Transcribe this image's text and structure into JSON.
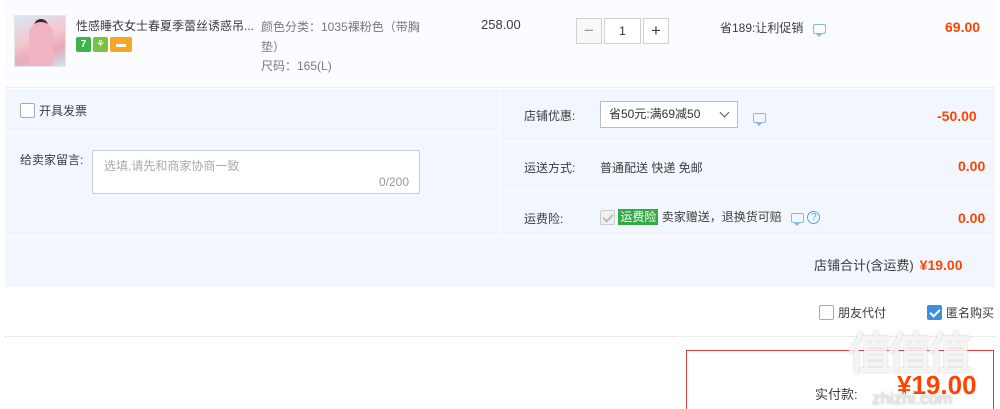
{
  "item": {
    "title": "性感睡衣女士春夏季蕾丝诱惑吊...",
    "badges": {
      "seven": "7"
    },
    "sku_color": "颜色分类：1035裸粉色（带胸垫）",
    "sku_size": "尺码：165(L)",
    "unit_price": "258.00",
    "quantity": "1",
    "promotion": "省189:让利促销",
    "subtotal": "69.00"
  },
  "invoice_label": "开具发票",
  "message": {
    "label": "给卖家留言:",
    "placeholder": "选填,请先和商家协商一致",
    "count": "0/200"
  },
  "shop_discount": {
    "label": "店铺优惠:",
    "selected": "省50元:满69减50",
    "value": "-50.00"
  },
  "shipping": {
    "label": "运送方式:",
    "method": "普通配送 快递 免邮",
    "value": "0.00"
  },
  "insurance": {
    "label": "运费险:",
    "tag": "运费险",
    "desc": "卖家赠送，退换货可赔",
    "help": "?",
    "value": "0.00"
  },
  "shop_total": {
    "label": "店铺合计(含运费)",
    "value": "¥19.00"
  },
  "options": {
    "friend_pay": "朋友代付",
    "anonymous": "匿名购买"
  },
  "payment": {
    "label": "实付款:",
    "value": "¥19.00"
  },
  "watermark": {
    "logo": "值值值",
    "url": "zhizhi.com"
  }
}
